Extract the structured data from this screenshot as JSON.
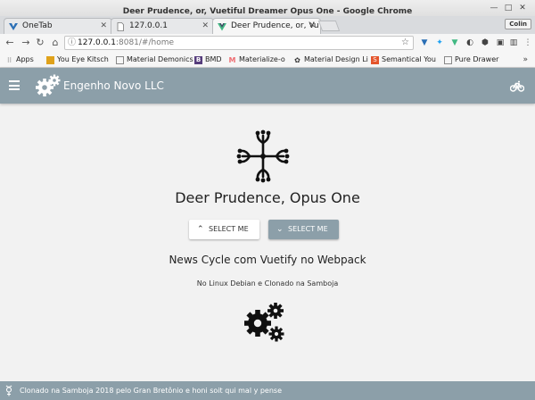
{
  "window": {
    "title": "Deer Prudence, or, Vuetiful Dreamer Opus One - Google Chrome",
    "profile": "Colin"
  },
  "tabs": [
    {
      "label": "OneTab",
      "icon": "onetab-icon"
    },
    {
      "label": "127.0.0.1",
      "icon": "page-icon"
    },
    {
      "label": "Deer Prudence, or, Vu",
      "icon": "vue-icon",
      "active": true
    }
  ],
  "omnibox": {
    "host": "127.0.0.1",
    "rest": ":8081/#/home"
  },
  "bookmarks": [
    {
      "label": "Apps",
      "icon": "apps-icon",
      "color": "#4a4a4a"
    },
    {
      "label": "You Eye Kitsch",
      "icon": "bookmark-icon",
      "color": "#e0a21b"
    },
    {
      "label": "Material Demonics",
      "icon": "page-icon",
      "color": "#888888"
    },
    {
      "label": "BMD",
      "icon": "B",
      "color": "#563d7c"
    },
    {
      "label": "Materialize-o",
      "icon": "M",
      "color": "#ee6e73"
    },
    {
      "label": "Material Design Li",
      "icon": "mdi-icon",
      "color": "#333333"
    },
    {
      "label": "Semantical You",
      "icon": "semantic-icon",
      "color": "#e4542b"
    },
    {
      "label": "Pure Drawer",
      "icon": "page-icon",
      "color": "#888888"
    }
  ],
  "app": {
    "brand": "Engenho Novo LLC",
    "headline": "Deer Prudence, Opus One",
    "buttons": {
      "up": "Select Me",
      "down": "Select Me"
    },
    "subhead": "News Cycle com Vuetify no Webpack",
    "small": "No Linux Debian e Clonado na Samboja",
    "footer": "Clonado na Samboja 2018 pelo Gran Bretônio e honi soit qui mal y pense"
  },
  "colors": {
    "primary": "#8c9fa9",
    "background": "#f2f2f2"
  }
}
